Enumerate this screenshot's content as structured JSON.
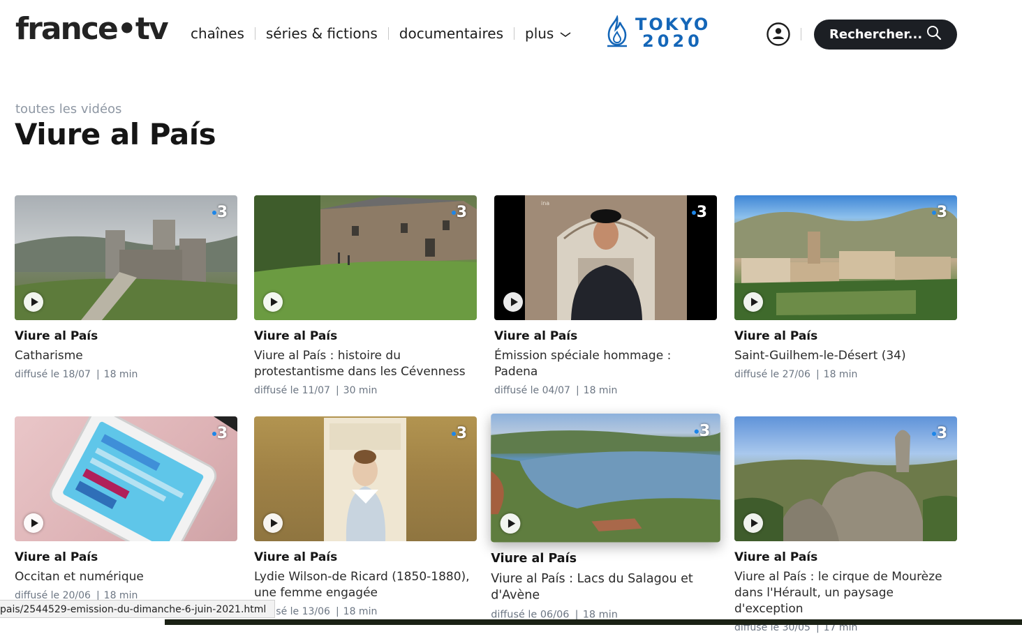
{
  "header": {
    "logo": "france•tv",
    "nav": [
      {
        "label": "chaînes"
      },
      {
        "label": "séries & fictions"
      },
      {
        "label": "documentaires"
      },
      {
        "label": "plus"
      }
    ],
    "event": {
      "line1": "TOKYO",
      "line2": "2020"
    },
    "search_label": "Rechercher..."
  },
  "page": {
    "breadcrumb": "toutes les vidéos",
    "title": "Viure al País"
  },
  "videos": [
    {
      "title": "Viure al País",
      "subtitle": "Catharisme",
      "broadcast": "diffusé le 18/07",
      "duration": "18 min",
      "channel": "3"
    },
    {
      "title": "Viure al País",
      "subtitle": "Viure al País : histoire du protestantisme dans les Cévenness",
      "broadcast": "diffusé le 11/07",
      "duration": "30 min",
      "channel": "3"
    },
    {
      "title": "Viure al País",
      "subtitle": "Émission spéciale hommage : Padena",
      "broadcast": "diffusé le 04/07",
      "duration": "18 min",
      "channel": "3"
    },
    {
      "title": "Viure al País",
      "subtitle": "Saint-Guilhem-le-Désert (34)",
      "broadcast": "diffusé le 27/06",
      "duration": "18 min",
      "channel": "3"
    },
    {
      "title": "Viure al País",
      "subtitle": "Occitan et numérique",
      "broadcast": "diffusé le 20/06",
      "duration": "18 min",
      "channel": "3"
    },
    {
      "title": "Viure al País",
      "subtitle": "Lydie Wilson-de Ricard (1850-1880), une femme engagée",
      "broadcast": "diffusé le 13/06",
      "duration": "18 min",
      "channel": "3"
    },
    {
      "title": "Viure al País",
      "subtitle": "Viure al País : Lacs du Salagou et d'Avène",
      "broadcast": "diffusé le 06/06",
      "duration": "18 min",
      "channel": "3"
    },
    {
      "title": "Viure al País",
      "subtitle": "Viure al País : le cirque de Mourèze dans l'Hérault, un paysage d'exception",
      "broadcast": "diffusé le 30/05",
      "duration": "17 min",
      "channel": "3"
    }
  ],
  "status_bar": {
    "url": "pais/2544529-emission-du-dimanche-6-juin-2021.html"
  },
  "colors": {
    "search_button_bg": "#1c1f24",
    "event_blue": "#1466b8",
    "meta_grey": "#6c7683",
    "channel_dot": "#1d86e8"
  },
  "icons": [
    "flame-icon",
    "account-icon",
    "search-icon",
    "chevron-down-icon",
    "play-icon"
  ]
}
